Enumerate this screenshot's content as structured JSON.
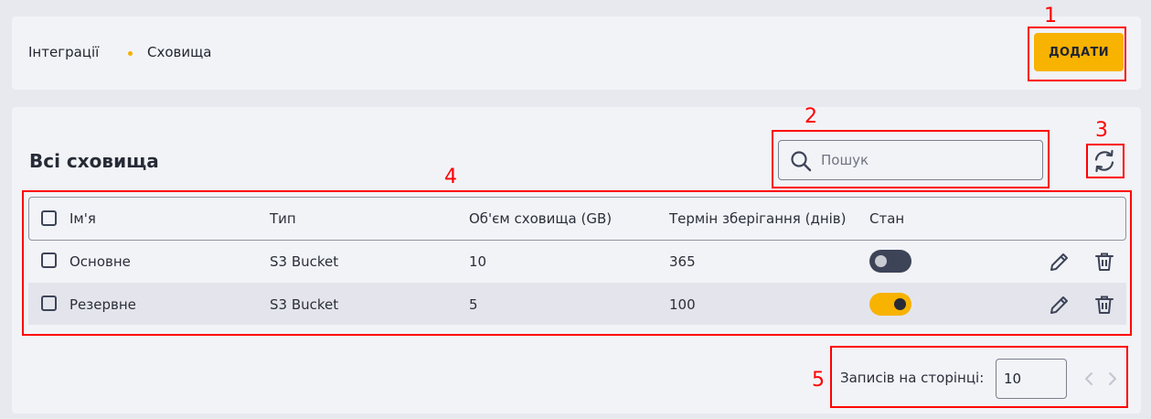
{
  "breadcrumb": {
    "items": [
      "Інтеграції",
      "Сховища"
    ]
  },
  "header": {
    "add_button": "ДОДАТИ"
  },
  "main": {
    "title": "Всі сховища",
    "search": {
      "placeholder": "Пошук",
      "value": ""
    }
  },
  "table": {
    "columns": [
      "Ім'я",
      "Тип",
      "Об'єм сховища (GB)",
      "Термін зберігання (днів)",
      "Стан"
    ],
    "rows": [
      {
        "name": "Основне",
        "type": "S3 Bucket",
        "volume": "10",
        "retention": "365",
        "enabled": false
      },
      {
        "name": "Резервне",
        "type": "S3 Bucket",
        "volume": "5",
        "retention": "100",
        "enabled": true
      }
    ]
  },
  "pagination": {
    "label": "Записів на сторінці:",
    "page_size": "10"
  },
  "annotations": [
    "1",
    "2",
    "3",
    "4",
    "5"
  ],
  "colors": {
    "accent": "#f8b200",
    "dark": "#3d4458",
    "marker": "#ff0000"
  }
}
